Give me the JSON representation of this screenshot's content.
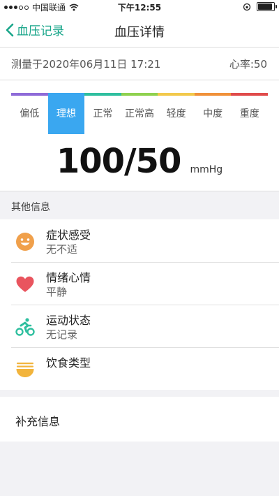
{
  "status_bar": {
    "carrier": "中国联通",
    "time": "下午12:55"
  },
  "nav": {
    "back_label": "血压记录",
    "title": "血压详情"
  },
  "measurement": {
    "time_text": "测量于2020年06月11日 17:21",
    "heart_rate_text": "心率:50"
  },
  "scale": {
    "active_index": 1,
    "levels": [
      {
        "label": "偏低",
        "color": "#8e6bd8"
      },
      {
        "label": "理想",
        "color": "#3aa7f0"
      },
      {
        "label": "正常",
        "color": "#2fbf9f"
      },
      {
        "label": "正常高",
        "color": "#8fd14f"
      },
      {
        "label": "轻度",
        "color": "#f2c94c"
      },
      {
        "label": "中度",
        "color": "#f0913a"
      },
      {
        "label": "重度",
        "color": "#e04b4b"
      }
    ]
  },
  "reading": {
    "value": "100/50",
    "unit": "mmHg"
  },
  "other_info": {
    "header": "其他信息",
    "items": [
      {
        "title": "症状感受",
        "value": "无不适",
        "icon": "smiley-icon"
      },
      {
        "title": "情绪心情",
        "value": "平静",
        "icon": "heart-icon"
      },
      {
        "title": "运动状态",
        "value": "无记录",
        "icon": "cycling-icon"
      },
      {
        "title": "饮食类型",
        "value": "",
        "icon": "noodle-bowl-icon"
      }
    ]
  },
  "supplement": {
    "label": "补充信息"
  },
  "colors": {
    "accent": "#17a589",
    "active_level": "#3aa7f0"
  }
}
